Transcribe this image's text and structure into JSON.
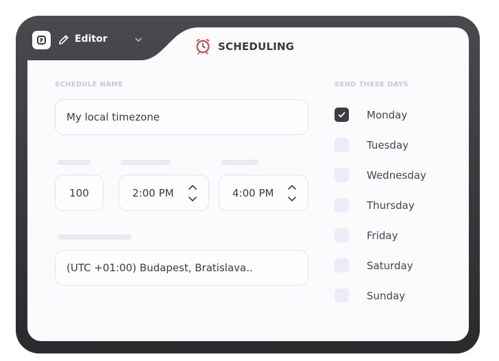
{
  "header": {
    "editor_label": "Editor",
    "tab_title": "SCHEDULING",
    "icons": [
      "app-logo-icon",
      "pencil-icon",
      "chevron-down-icon",
      "alarm-clock-icon"
    ]
  },
  "form": {
    "schedule_name_label": "SCHEDULE NAME",
    "schedule_name_value": "My local timezone",
    "quantity_value": "100",
    "start_time_value": "2:00 PM",
    "end_time_value": "4:00 PM",
    "timezone_value": "(UTC +01:00) Budapest, Bratislava.."
  },
  "days": {
    "label": "SEND THESE DAYS",
    "items": [
      {
        "label": "Monday",
        "checked": true
      },
      {
        "label": "Tuesday",
        "checked": false
      },
      {
        "label": "Wednesday",
        "checked": false
      },
      {
        "label": "Thursday",
        "checked": false
      },
      {
        "label": "Friday",
        "checked": false
      },
      {
        "label": "Saturday",
        "checked": false
      },
      {
        "label": "Sunday",
        "checked": false
      }
    ]
  },
  "colors": {
    "frame": "#3a3a3e",
    "panel": "#fbfbfd",
    "checkbox_checked": "#3d3d42",
    "checkbox_unchecked": "#ecebfa",
    "alarm_red": "#e0443b"
  }
}
